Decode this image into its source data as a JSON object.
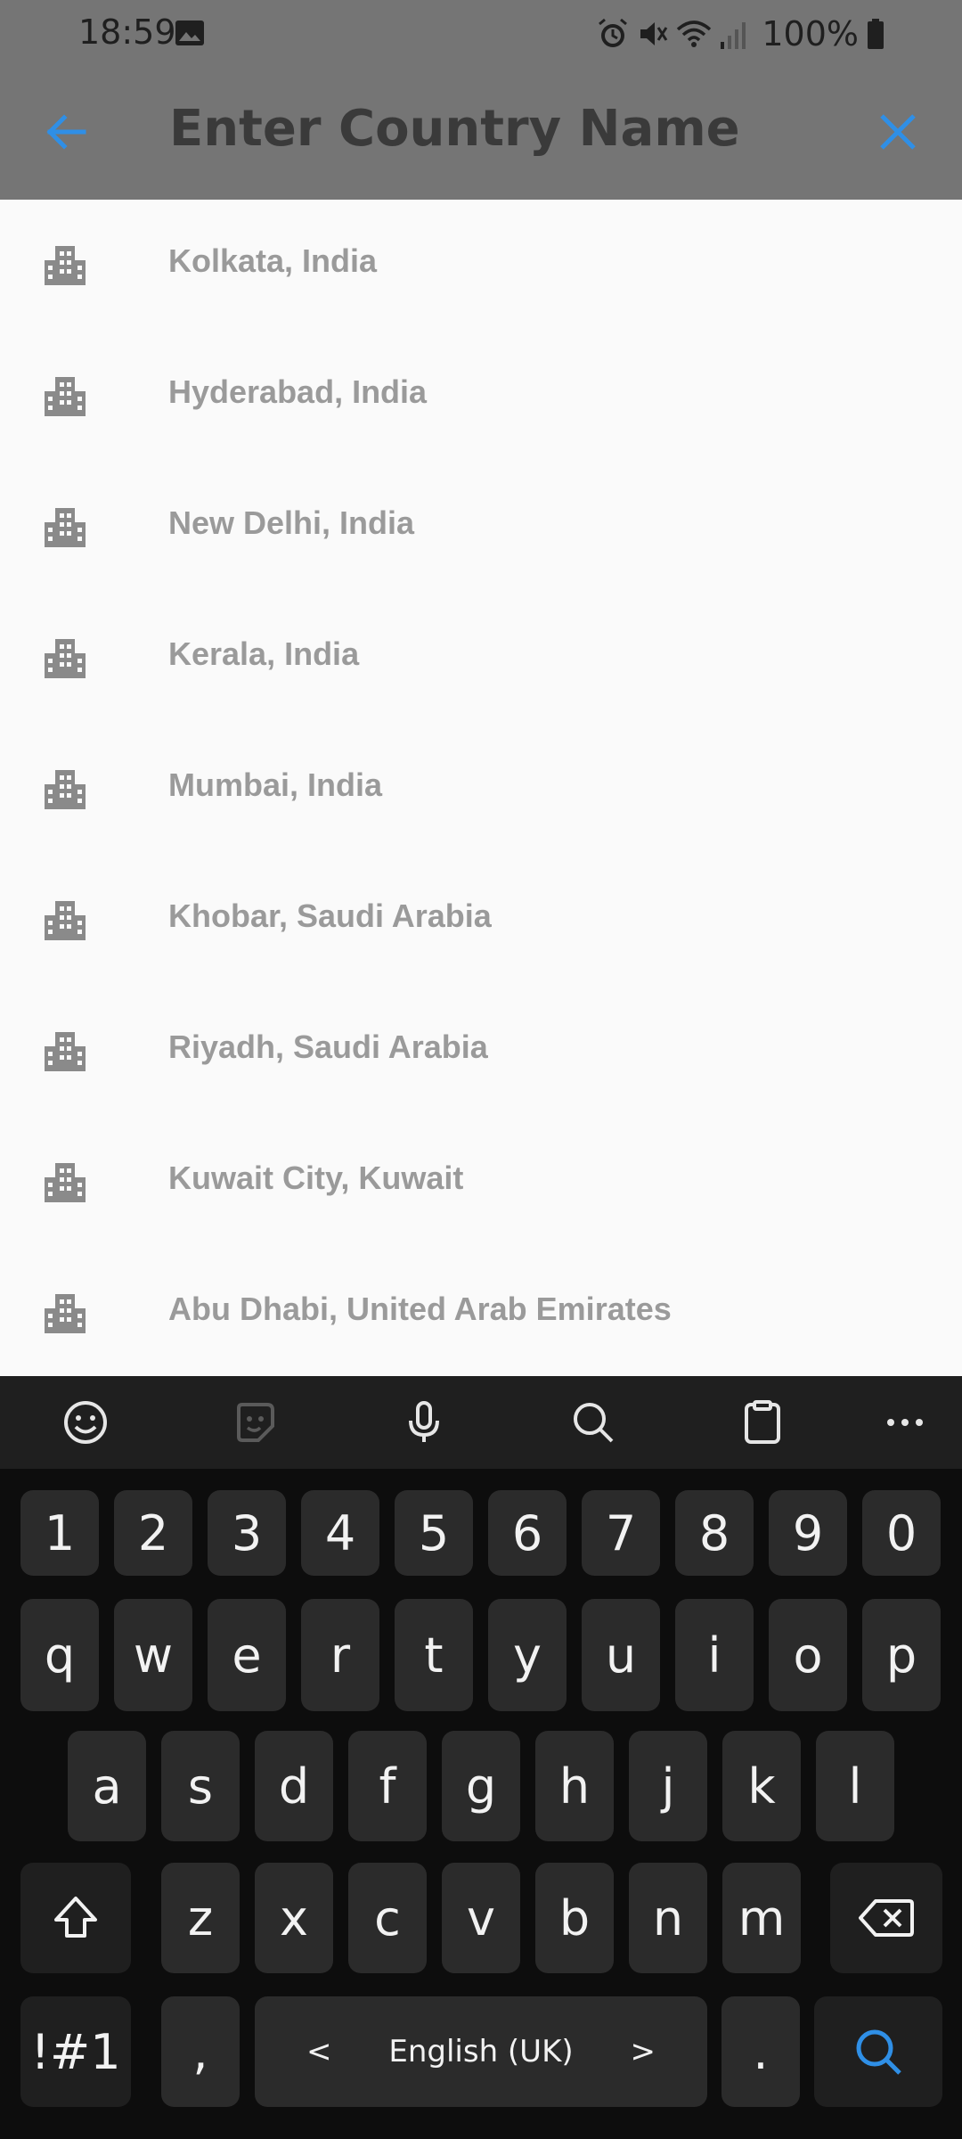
{
  "status_bar": {
    "time": "18:59",
    "battery": "100%",
    "icons": [
      "gallery-icon",
      "alarm-icon",
      "mute-icon",
      "wifi-icon",
      "signal-icon",
      "battery-icon"
    ]
  },
  "app_bar": {
    "title": "Enter Country Name",
    "back_icon": "arrow-left-icon",
    "close_icon": "close-icon",
    "accent": "#2f8fe6",
    "background": "#757575"
  },
  "cities": [
    {
      "label": "Kolkata, India"
    },
    {
      "label": "Hyderabad, India"
    },
    {
      "label": "New Delhi, India"
    },
    {
      "label": "Kerala, India"
    },
    {
      "label": "Mumbai, India"
    },
    {
      "label": "Khobar, Saudi Arabia"
    },
    {
      "label": "Riyadh, Saudi Arabia"
    },
    {
      "label": "Kuwait City, Kuwait"
    },
    {
      "label": "Abu Dhabi, United Arab Emirates"
    }
  ],
  "keyboard": {
    "toolbar": [
      "emoji-icon",
      "sticker-icon",
      "microphone-icon",
      "search-icon",
      "clipboard-icon",
      "more-icon"
    ],
    "row_numbers": [
      "1",
      "2",
      "3",
      "4",
      "5",
      "6",
      "7",
      "8",
      "9",
      "0"
    ],
    "row_q": [
      "q",
      "w",
      "e",
      "r",
      "t",
      "y",
      "u",
      "i",
      "o",
      "p"
    ],
    "row_a": [
      "a",
      "s",
      "d",
      "f",
      "g",
      "h",
      "j",
      "k",
      "l"
    ],
    "row_z": [
      "z",
      "x",
      "c",
      "v",
      "b",
      "n",
      "m"
    ],
    "symbols_key": "!#1",
    "comma_key": ",",
    "space_label": "English (UK)",
    "space_left": "<",
    "space_right": ">",
    "period_key": ".",
    "action_icon": "search-icon"
  }
}
